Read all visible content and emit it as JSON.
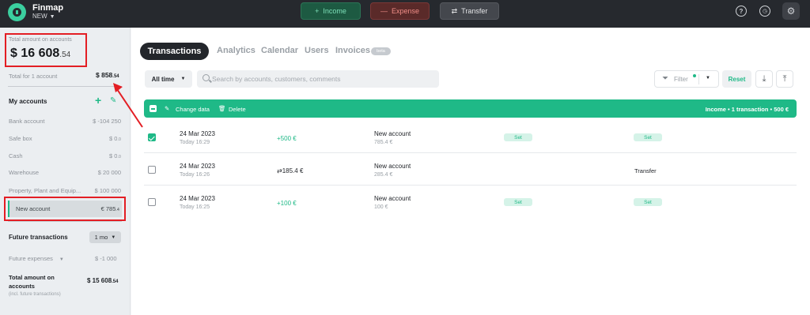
{
  "app": {
    "name": "Finmap",
    "workspace": "NEW"
  },
  "topbar": {
    "income_label": "Income",
    "expense_label": "Expense",
    "transfer_label": "Transfer",
    "income_icon": "+",
    "expense_icon": "—",
    "transfer_icon": "⇄",
    "help_icon": "question-icon",
    "history_icon": "history-icon",
    "settings_icon": "gear-icon"
  },
  "sidebar": {
    "total_label": "Total amount on accounts",
    "total_currency": "$",
    "total_main": "16 608",
    "total_cents": ".54",
    "total_one_label": "Total for 1 account",
    "total_one_main": "$ 858",
    "total_one_cents": ".54",
    "my_accounts_label": "My accounts",
    "accounts": [
      {
        "name": "Bank account",
        "main": "$ -104 250",
        "cents": ""
      },
      {
        "name": "Safe box",
        "main": "$ 0",
        "cents": ".0"
      },
      {
        "name": "Cash",
        "main": "$ 0",
        "cents": ".0"
      },
      {
        "name": "Warehouse",
        "main": "$ 20 000",
        "cents": ""
      },
      {
        "name": "Property, Plant and Equip...",
        "main": "$ 100 000",
        "cents": ""
      }
    ],
    "selected_account": {
      "name": "New account",
      "main": "€ 785",
      "cents": ".4"
    },
    "future_label": "Future transactions",
    "future_period": "1 mo",
    "future_expenses_label": "Future expenses",
    "future_expenses_value": "$ -1 000",
    "total_future_label": "Total amount on accounts",
    "total_future_main": "$ 15 608",
    "total_future_cents": ".54",
    "total_future_sub": "(incl. future transactions)"
  },
  "tabs": {
    "transactions": "Transactions",
    "analytics": "Analytics",
    "calendar": "Calendar",
    "users": "Users",
    "invoices": "Invoices",
    "beta_badge": "beta"
  },
  "toolbar": {
    "period": "All time",
    "search_placeholder": "Search by accounts, customers, comments",
    "filter_label": "Filter",
    "reset_label": "Reset"
  },
  "selection_bar": {
    "change_data": "Change data",
    "delete": "Delete",
    "summary": "Income • 1 transaction • 500 €"
  },
  "transactions": [
    {
      "checked": true,
      "date": "24 Mar 2023",
      "time": "Today 16:29",
      "amount": "+500 €",
      "account": "New account",
      "account_value": "785.4 €",
      "category": "Set",
      "project": "Set",
      "type": ""
    },
    {
      "checked": false,
      "date": "24 Mar 2023",
      "time": "Today 16:26",
      "amount": "⇄185.4 €",
      "account": "New account",
      "account_value": "285.4 €",
      "category": "",
      "project": "",
      "type": "Transfer"
    },
    {
      "checked": false,
      "date": "24 Mar 2023",
      "time": "Today 16:25",
      "amount": "+100 €",
      "account": "New account",
      "account_value": "100 €",
      "category": "Set",
      "project": "Set",
      "type": ""
    }
  ],
  "colors": {
    "accent": "#1fb987",
    "topbar": "#26292e",
    "annotation": "#e31e24"
  }
}
